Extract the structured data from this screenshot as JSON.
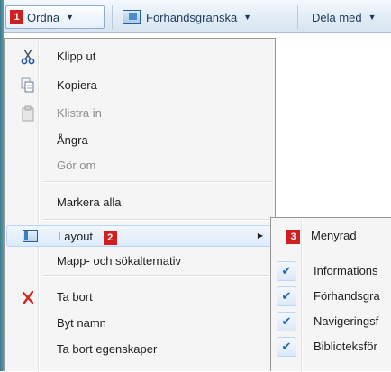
{
  "toolbar": {
    "organize": {
      "badge": "1",
      "label": "Ordna"
    },
    "preview": {
      "label": "Förhandsgranska"
    },
    "share": {
      "label": "Dela med"
    }
  },
  "menu": {
    "items": [
      {
        "label": "Klipp ut",
        "icon": "scissors-icon",
        "enabled": true
      },
      {
        "label": "Kopiera",
        "icon": "copy-icon",
        "enabled": true
      },
      {
        "label": "Klistra in",
        "icon": "paste-icon",
        "enabled": false
      },
      {
        "label": "Ångra",
        "enabled": true
      },
      {
        "label": "Gör om",
        "enabled": false
      },
      {
        "label": "Markera alla",
        "enabled": true
      },
      {
        "label": "Layout",
        "badge": "2",
        "icon": "layout-icon",
        "enabled": true,
        "has_submenu": true
      },
      {
        "label": "Mapp- och sökalternativ",
        "enabled": true
      },
      {
        "label": "Ta bort",
        "icon": "delete-icon",
        "enabled": true
      },
      {
        "label": "Byt namn",
        "enabled": true
      },
      {
        "label": "Ta bort egenskaper",
        "enabled": true
      }
    ]
  },
  "submenu": {
    "items": [
      {
        "label": "Menyrad",
        "badge": "3",
        "checked": false
      },
      {
        "label": "Informations",
        "checked": true
      },
      {
        "label": "Förhandsgra",
        "checked": true
      },
      {
        "label": "Navigeringsf",
        "checked": true
      },
      {
        "label": "Biblioteksför",
        "checked": true
      }
    ]
  },
  "colors": {
    "badge": "#d11f1f",
    "check": "#1d5fb2",
    "accent_border": "#b8d6fb"
  }
}
